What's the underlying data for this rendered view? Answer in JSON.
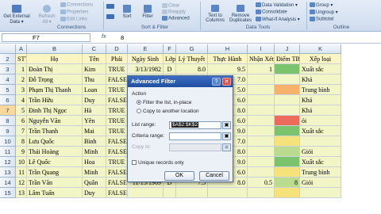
{
  "ribbon": {
    "get_external": [
      "Get External",
      "Data ▾"
    ],
    "refresh": [
      "Refresh",
      "All ▾"
    ],
    "connections_items": [
      "Connections",
      "Properties",
      "Edit Links"
    ],
    "sort_filter_items": [
      "Sort",
      "Filter",
      "Clear",
      "Reapply",
      "Advanced"
    ],
    "data_tools_items": [
      "Text to",
      "Columns",
      "Remove",
      "Duplicates"
    ],
    "data_tools_right": [
      "Data Validation ▾",
      "Consolidate",
      "What-If Analysis ▾"
    ],
    "outline_items": [
      "Group ▾",
      "Ungroup ▾",
      "Subtotal"
    ],
    "groups": [
      "Connections",
      "Sort & Filter",
      "Data Tools",
      "Outline"
    ]
  },
  "formula_bar": {
    "name_box": "F7",
    "fx": "fx",
    "value": "8"
  },
  "columns": [
    "A",
    "B",
    "C",
    "D",
    "E",
    "F",
    "G",
    "H",
    "I",
    "J",
    "K"
  ],
  "headers": [
    "STT",
    "Họ",
    "Tên",
    "Phái",
    "Ngày Sinh",
    "Lớp",
    "Lý Thuyết",
    "Thực Hành",
    "Nhận Xét",
    "Điểm TB",
    "Xếp loại"
  ],
  "rows": [
    {
      "r": "3",
      "cells": [
        "1",
        "Đoàn Thị",
        "Kim",
        "TRUE",
        "3/13/1982",
        "D",
        "8.0",
        "9.5",
        "1",
        "",
        "Xuất sắc"
      ]
    },
    {
      "r": "4",
      "cells": [
        "2",
        "Đỗ Trọng",
        "Thu",
        "FALSE",
        "",
        "",
        "",
        "7.0",
        "",
        "",
        "Khá"
      ]
    },
    {
      "r": "5",
      "cells": [
        "3",
        "Phạm Thị Thanh",
        "Loan",
        "TRUE",
        "",
        "",
        "",
        "5.0",
        "",
        "",
        "Trung bình"
      ]
    },
    {
      "r": "6",
      "cells": [
        "4",
        "Trần Hữu",
        "Duy",
        "FALSE",
        "",
        "",
        "",
        "6.0",
        "",
        "",
        "Khá"
      ]
    },
    {
      "r": "7",
      "cells": [
        "5",
        "Đinh Thị Ngọc",
        "Hà",
        "TRUE",
        "",
        "",
        "",
        "8.0",
        "",
        "",
        "Khá"
      ]
    },
    {
      "r": "8",
      "cells": [
        "6",
        "Nguyễn Văn",
        "Yên",
        "TRUE",
        "",
        "",
        "",
        "6.0",
        "",
        "",
        "ỏi"
      ]
    },
    {
      "r": "9",
      "cells": [
        "7",
        "Trần Thanh",
        "Mai",
        "TRUE",
        "",
        "",
        "",
        "9.0",
        "",
        "",
        "Xuất sắc"
      ]
    },
    {
      "r": "10",
      "cells": [
        "8",
        "Lưu Quốc",
        "Bình",
        "FALSE",
        "",
        "",
        "",
        "7.0",
        "",
        "",
        ""
      ]
    },
    {
      "r": "11",
      "cells": [
        "9",
        "Thái Hoàng",
        "Minh",
        "FALSE",
        "",
        "",
        "",
        "8.0",
        "",
        "",
        "Giỏi"
      ]
    },
    {
      "r": "12",
      "cells": [
        "10",
        "Lê Quốc",
        "Hoa",
        "TRUE",
        "",
        "",
        "",
        "9.0",
        "",
        "",
        "Xuất sắc"
      ]
    },
    {
      "r": "13",
      "cells": [
        "11",
        "Trần Quang",
        "Minh",
        "FALSE",
        "",
        "",
        "",
        "6.0",
        "",
        "",
        "Trung bình"
      ]
    },
    {
      "r": "14",
      "cells": [
        "12",
        "Trần Văn",
        "Quân",
        "FALSE",
        "11/15/1969",
        "D",
        "7.5",
        "8.0",
        "0.5",
        "8",
        "Giỏi"
      ]
    },
    {
      "r": "15",
      "cells": [
        "13",
        "Lâm Tuấn",
        "Duy",
        "FALSE",
        "",
        "",
        "",
        "",
        "",
        "",
        ""
      ]
    }
  ],
  "dialog": {
    "title": "Advanced Filter",
    "help": "?",
    "close": "✕",
    "action_label": "Action",
    "opt_inplace": "Filter the list, in-place",
    "opt_copy": "Copy to another location",
    "list_range_label": "List range:",
    "list_range_value": "$A$2:$K$2",
    "criteria_label": "Criteria range:",
    "copy_to_label": "Copy to:",
    "unique_label": "Unique records only",
    "ok": "OK",
    "cancel": "Cancel"
  },
  "colors": {
    "green": "#7cc36e",
    "lightgreen": "#b9dc8f",
    "yellow": "#f5e27a",
    "orange": "#f6b26b",
    "red": "#ec6b5b"
  },
  "score_colors": [
    "green",
    "",
    "orange",
    "",
    "",
    "red",
    "green",
    "yellow",
    "lightgreen",
    "green",
    "yellow",
    "lightgreen",
    "yellow"
  ]
}
